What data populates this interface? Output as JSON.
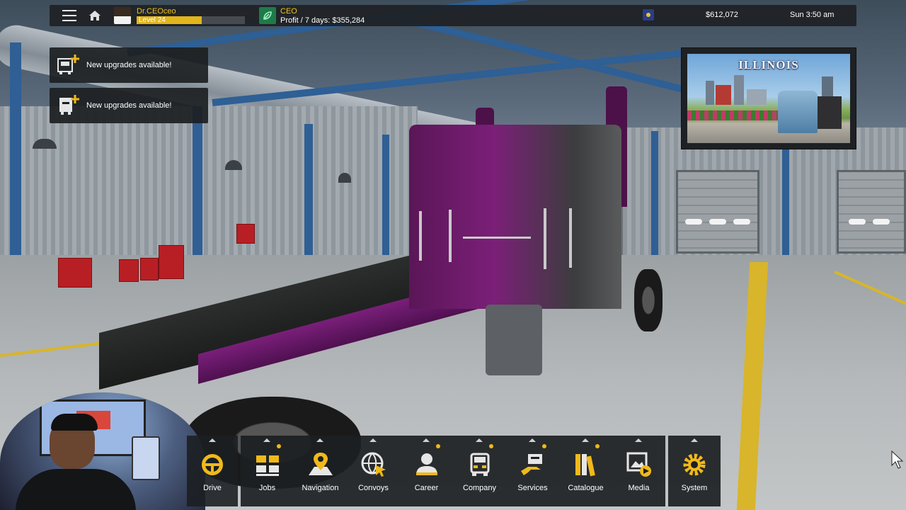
{
  "topbar": {
    "player_name": "Dr.CEOceo",
    "level_label": "Level 24",
    "level_progress": 0.6,
    "role_title": "CEO",
    "profit_text": "Profit / 7 days: $355,284",
    "money": "$612,072",
    "clock": "Sun 3:50 am",
    "icons": [
      "menu-icon",
      "home-icon",
      "player-avatar",
      "ceo-leaf-badge",
      "state-flag-icon"
    ]
  },
  "notifications": [
    {
      "text": "New upgrades available!",
      "icon": "truck-upgrade-icon"
    },
    {
      "text": "New upgrades available!",
      "icon": "trailer-upgrade-icon"
    }
  ],
  "billboard": {
    "title": "ILLINOIS"
  },
  "dock": {
    "accent": "#f0b91b",
    "items": [
      {
        "label": "Drive",
        "icon": "steering-wheel-icon",
        "badge": false
      },
      {
        "label": "Jobs",
        "icon": "cargo-boxes-icon",
        "badge": true
      },
      {
        "label": "Navigation",
        "icon": "map-pin-icon",
        "badge": false
      },
      {
        "label": "Convoys",
        "icon": "globe-cursor-icon",
        "badge": false
      },
      {
        "label": "Career",
        "icon": "person-icon",
        "badge": true
      },
      {
        "label": "Company",
        "icon": "truck-front-icon",
        "badge": true
      },
      {
        "label": "Services",
        "icon": "service-hand-icon",
        "badge": true
      },
      {
        "label": "Catalogue",
        "icon": "books-icon",
        "badge": true
      },
      {
        "label": "Media",
        "icon": "media-play-icon",
        "badge": false
      },
      {
        "label": "System",
        "icon": "gear-icon",
        "badge": false
      }
    ]
  }
}
